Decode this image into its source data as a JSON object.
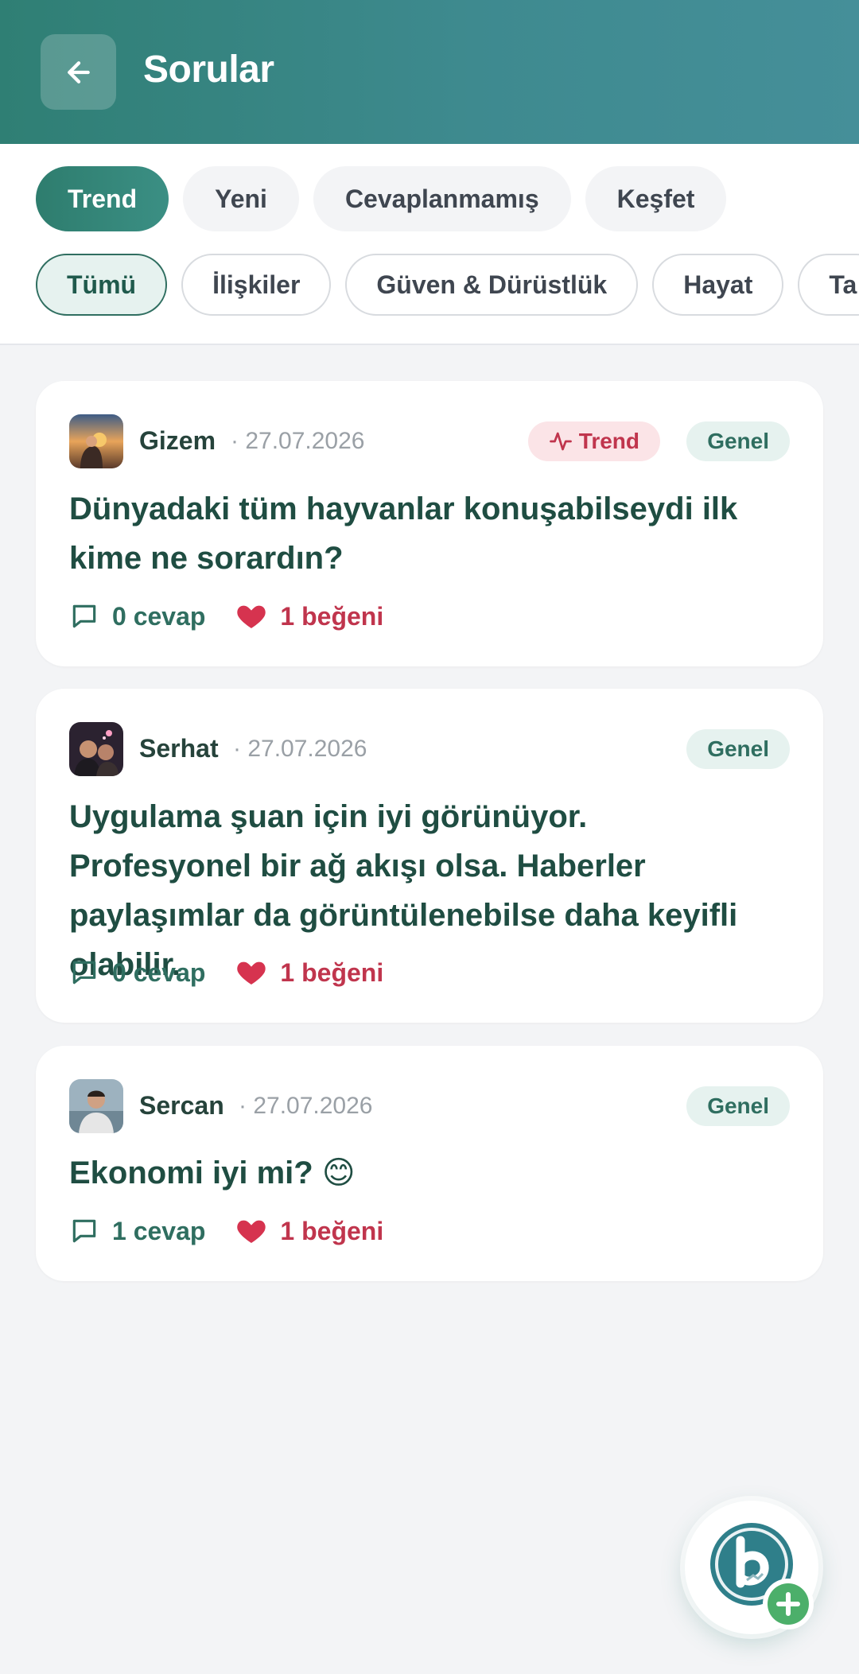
{
  "header": {
    "title": "Sorular"
  },
  "tabs": [
    {
      "label": "Trend",
      "active": true
    },
    {
      "label": "Yeni",
      "active": false
    },
    {
      "label": "Cevaplanmamış",
      "active": false
    },
    {
      "label": "Keşfet",
      "active": false
    }
  ],
  "categories": [
    {
      "label": "Tümü",
      "active": true
    },
    {
      "label": "İlişkiler",
      "active": false
    },
    {
      "label": "Güven & Dürüstlük",
      "active": false
    },
    {
      "label": "Hayat",
      "active": false
    },
    {
      "label": "Ta",
      "active": false
    }
  ],
  "questions": [
    {
      "author": "Gizem",
      "date": "· 27.07.2026",
      "trend_label": "Trend",
      "category": "Genel",
      "text": "Dünyadaki tüm hayvanlar konuşabilseydi ilk kime ne sorardın?",
      "answers": "0 cevap",
      "likes": "1 beğeni"
    },
    {
      "author": "Serhat",
      "date": "· 27.07.2026",
      "category": "Genel",
      "text": "Uygulama şuan için iyi görünüyor. Profesyonel bir ağ akışı olsa. Haberler paylaşımlar da görüntülenebilse daha keyifli olabilir.",
      "answers": "0 cevap",
      "likes": "1 beğeni"
    },
    {
      "author": "Sercan",
      "date": "· 27.07.2026",
      "category": "Genel",
      "text": "Ekonomi iyi mi? 😊",
      "answers": "1 cevap",
      "likes": "1 beğeni"
    }
  ],
  "colors": {
    "header_start": "#2f7f74",
    "header_end": "#458f99",
    "accent": "#2f6e60",
    "like": "#c0354d",
    "fab_plus": "#4caf6a"
  },
  "icons": {
    "back": "arrow-left-icon",
    "trend": "activity-icon",
    "answers": "chat-bubble-icon",
    "likes": "heart-icon",
    "fab": "app-logo-plus-icon"
  }
}
